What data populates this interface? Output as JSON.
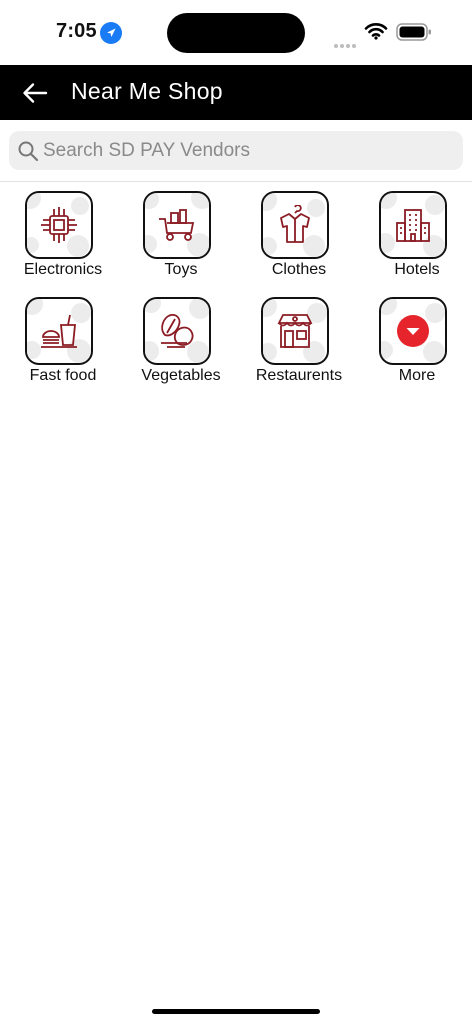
{
  "status_bar": {
    "time": "7:05"
  },
  "header": {
    "title": "Near Me Shop"
  },
  "search": {
    "placeholder": "Search SD PAY Vendors"
  },
  "categories": [
    {
      "label": "Electronics",
      "icon": "microchip-icon"
    },
    {
      "label": "Toys",
      "icon": "toy-cart-icon"
    },
    {
      "label": "Clothes",
      "icon": "shirt-hanger-icon"
    },
    {
      "label": "Hotels",
      "icon": "hotel-building-icon"
    },
    {
      "label": "Fast food",
      "icon": "fast-food-icon"
    },
    {
      "label": "Vegetables",
      "icon": "vegetables-icon"
    },
    {
      "label": "Restaurents",
      "icon": "restaurant-store-icon"
    },
    {
      "label": "More",
      "icon": "chevron-down-icon"
    }
  ],
  "colors": {
    "accent": "#8b1c24",
    "more_button": "#e5252b",
    "header_bg": "#000000",
    "location": "#1a7cf5"
  }
}
